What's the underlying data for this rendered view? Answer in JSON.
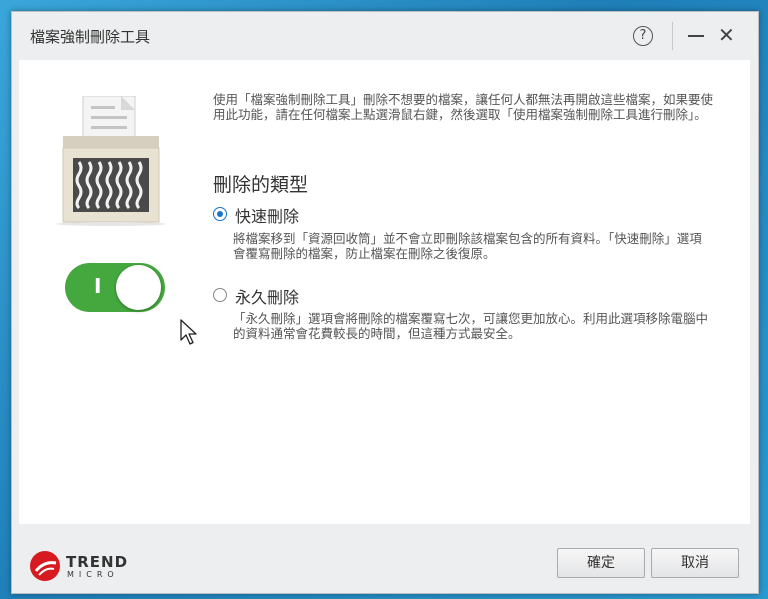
{
  "window": {
    "title": "檔案強制刪除工具",
    "help_glyph": "?",
    "close_glyph": "✕"
  },
  "toggle": {
    "label": "I",
    "state": "on",
    "color": "#45a83f"
  },
  "description": "使用「檔案強制刪除工具」刪除不想要的檔案，讓任何人都無法再開啟這些檔案，如果要使用此功能，請在任何檔案上點選滑鼠右鍵，然後選取「使用檔案強制刪除工具進行刪除」。",
  "delete_type": {
    "title": "刪除的類型",
    "options": [
      {
        "label": "快速刪除",
        "selected": true,
        "description": "將檔案移到「資源回收筒」並不會立即刪除該檔案包含的所有資料。「快速刪除」選項會覆寫刪除的檔案，防止檔案在刪除之後復原。"
      },
      {
        "label": "永久刪除",
        "selected": false,
        "description": "「永久刪除」選項會將刪除的檔案覆寫七次，可讓您更加放心。利用此選項移除電腦中的資料通常會花費較長的時間，但這種方式最安全。"
      }
    ]
  },
  "footer": {
    "logo_top": "TREND",
    "logo_bottom": "MICRO",
    "ok_label": "確定",
    "cancel_label": "取消"
  },
  "colors": {
    "accent_blue": "#1a73c9",
    "brand_red": "#d71920"
  }
}
